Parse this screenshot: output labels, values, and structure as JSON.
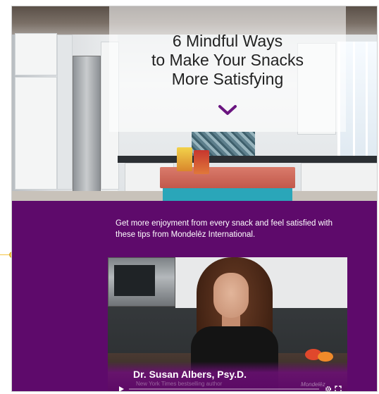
{
  "hero": {
    "title_line1": "6 Mindful Ways",
    "title_line2": "to Make Your Snacks",
    "title_line3": "More Satisfying",
    "scroll_icon": "chevron-down-icon"
  },
  "intro": {
    "text": "Get more enjoyment from every snack and feel satisfied with these tips from Mondelēz International."
  },
  "video": {
    "speaker_name": "Dr. Susan Albers, Psy.D.",
    "speaker_subtitle": "New York Times bestselling author",
    "watermark": "Mondelēz",
    "play_icon": "play-icon",
    "settings_icon": "gear-icon",
    "fullscreen_icon": "fullscreen-icon"
  },
  "colors": {
    "background_purple": "#5e0a6b",
    "accent_purple": "#6a1580",
    "connector_yellow": "#f5c542"
  }
}
